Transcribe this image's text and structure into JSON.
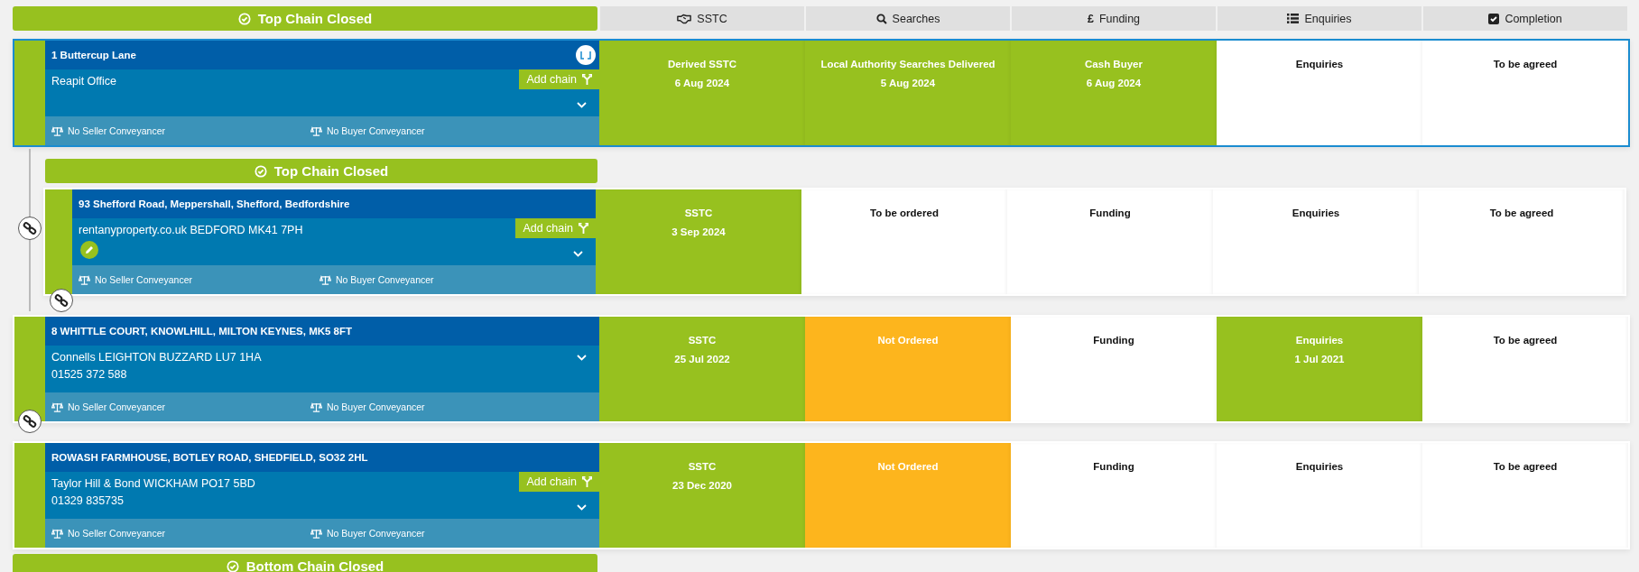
{
  "top_banner": {
    "label": "Top Chain Closed"
  },
  "columns": [
    {
      "label": "SSTC"
    },
    {
      "label": "Searches"
    },
    {
      "label": "Funding",
      "glyph": "£"
    },
    {
      "label": "Enquiries"
    },
    {
      "label": "Completion"
    }
  ],
  "rows": [
    {
      "kind": "main",
      "selected": true,
      "badge": true,
      "edit_button": false,
      "address": "1 Buttercup Lane",
      "agent_lines": [
        "Reapit Office"
      ],
      "add_chain": "Add chain",
      "seller_conveyancer": "No Seller Conveyancer",
      "buyer_conveyancer": "No Buyer Conveyancer",
      "stages": [
        {
          "kind": "done",
          "title": "Derived SSTC",
          "date": "6 Aug 2024"
        },
        {
          "kind": "done",
          "title": "Local Authority Searches Delivered",
          "date": "5 Aug 2024"
        },
        {
          "kind": "done",
          "title": "Cash Buyer",
          "date": "6 Aug 2024"
        },
        {
          "kind": "pending",
          "title": "Enquiries"
        },
        {
          "kind": "pending",
          "title": "To be agreed"
        }
      ]
    },
    {
      "kind": "linked",
      "banner": "Top Chain Closed",
      "selected": false,
      "badge": false,
      "edit_button": true,
      "address": "93 Shefford Road, Meppershall, Shefford, Bedfordshire",
      "agent_lines": [
        "rentanyproperty.co.uk BEDFORD MK41 7PH"
      ],
      "add_chain": "Add chain",
      "seller_conveyancer": "No Seller Conveyancer",
      "buyer_conveyancer": "No Buyer Conveyancer",
      "stages": [
        {
          "kind": "done",
          "title": "SSTC",
          "date": "3 Sep 2024"
        },
        {
          "kind": "pending",
          "title": "To be ordered"
        },
        {
          "kind": "pending",
          "title": "Funding"
        },
        {
          "kind": "pending",
          "title": "Enquiries"
        },
        {
          "kind": "pending",
          "title": "To be agreed"
        }
      ]
    },
    {
      "kind": "main",
      "selected": false,
      "badge": false,
      "edit_button": false,
      "address": "8 WHITTLE COURT, KNOWLHILL, MILTON KEYNES, MK5 8FT",
      "agent_lines": [
        "Connells LEIGHTON BUZZARD LU7 1HA",
        "01525 372 588"
      ],
      "seller_conveyancer": "No Seller Conveyancer",
      "buyer_conveyancer": "No Buyer Conveyancer",
      "stages": [
        {
          "kind": "done",
          "title": "SSTC",
          "date": "25 Jul 2022"
        },
        {
          "kind": "warning",
          "title": "Not Ordered"
        },
        {
          "kind": "pending",
          "title": "Funding"
        },
        {
          "kind": "done",
          "title": "Enquiries",
          "date": "1 Jul 2021"
        },
        {
          "kind": "pending",
          "title": "To be agreed"
        }
      ]
    },
    {
      "kind": "main",
      "selected": false,
      "badge": false,
      "edit_button": false,
      "address": "ROWASH FARMHOUSE, BOTLEY ROAD, SHEDFIELD, SO32 2HL",
      "agent_lines": [
        "Taylor Hill & Bond WICKHAM PO17 5BD",
        "01329 835735"
      ],
      "add_chain": "Add chain",
      "seller_conveyancer": "No Seller Conveyancer",
      "buyer_conveyancer": "No Buyer Conveyancer",
      "stages": [
        {
          "kind": "done",
          "title": "SSTC",
          "date": "23 Dec 2020"
        },
        {
          "kind": "warning",
          "title": "Not Ordered"
        },
        {
          "kind": "pending",
          "title": "Funding"
        },
        {
          "kind": "pending",
          "title": "Enquiries"
        },
        {
          "kind": "pending",
          "title": "To be agreed"
        }
      ]
    }
  ],
  "bottom_banner": {
    "label": "Bottom Chain Closed"
  }
}
